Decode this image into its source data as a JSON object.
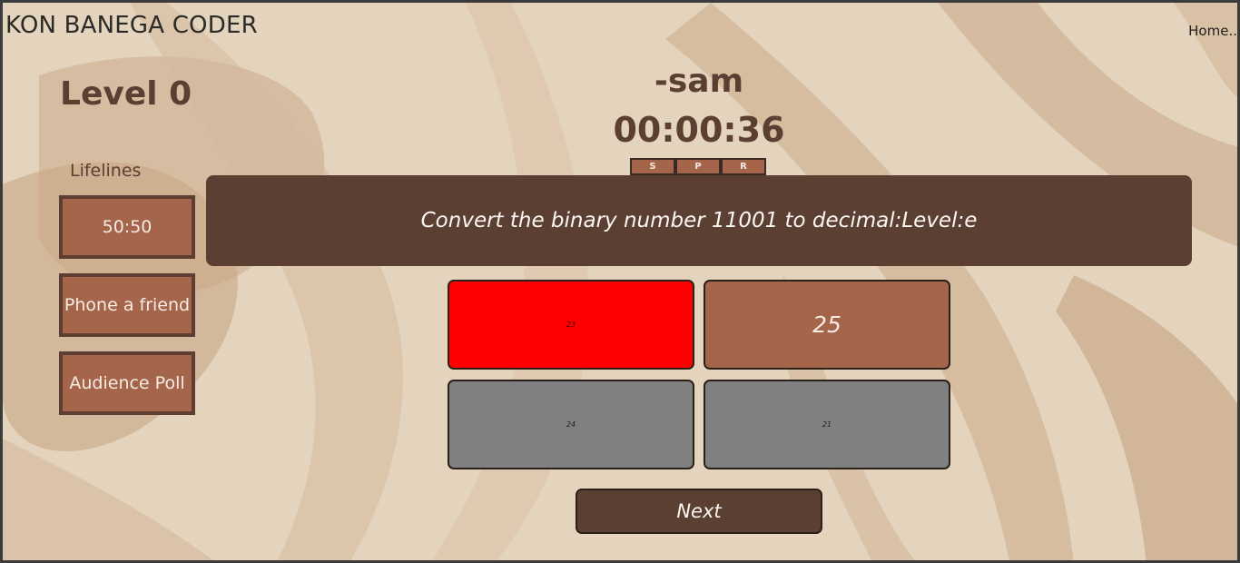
{
  "header": {
    "app_title": "KON BANEGA CODER",
    "home_link": "Home.."
  },
  "sidebar": {
    "level_title": "Level 0",
    "lifelines_label": "Lifelines",
    "lifelines": [
      {
        "label": "50:50"
      },
      {
        "label": "Phone a friend"
      },
      {
        "label": "Audience Poll"
      }
    ]
  },
  "player": {
    "name": "-sam",
    "timer": "00:00:36"
  },
  "controls": [
    {
      "label": "S"
    },
    {
      "label": "P"
    },
    {
      "label": "R"
    }
  ],
  "question": {
    "text": "Convert the binary number 11001 to decimal:Level:e"
  },
  "options": [
    {
      "label": "23",
      "state": "wrong",
      "color": "#ff0000"
    },
    {
      "label": "25",
      "state": "correct",
      "color": "#a5654b"
    },
    {
      "label": "24",
      "state": "disabled",
      "color": "#808080"
    },
    {
      "label": "21",
      "state": "disabled",
      "color": "#808080"
    }
  ],
  "next_button": {
    "label": "Next"
  },
  "theme": {
    "background": "#e3d3bd",
    "primary_dark": "#5c3f33",
    "accent": "#a5654b"
  }
}
